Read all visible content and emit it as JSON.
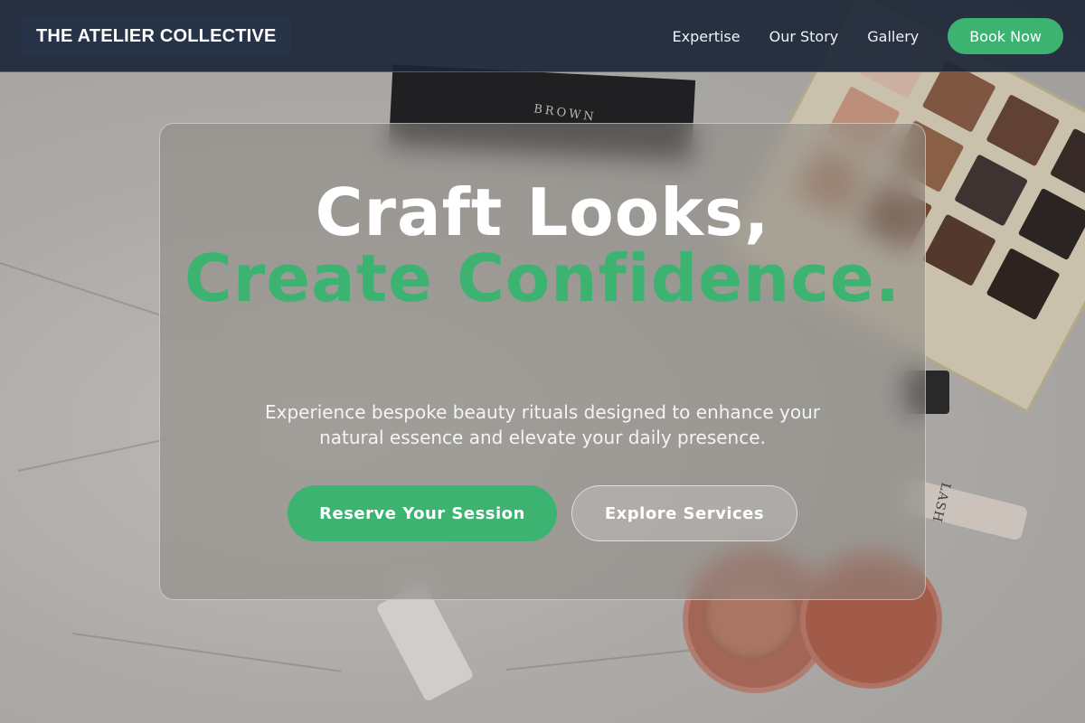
{
  "header": {
    "brand": "THE ATELIER COLLECTIVE",
    "nav": [
      {
        "label": "Expertise"
      },
      {
        "label": "Our Story"
      },
      {
        "label": "Gallery"
      }
    ],
    "book_label": "Book Now"
  },
  "hero": {
    "headline_line1": "Craft Looks,",
    "headline_line2": "Create Confidence.",
    "subtitle": "Experience bespoke beauty rituals designed to enhance your natural essence and elevate your daily presence.",
    "primary_cta": "Reserve Your Session",
    "secondary_cta": "Explore Services"
  },
  "background": {
    "compact_brand_text": "BROWN",
    "mascara_text": "LASH"
  },
  "colors": {
    "accent": "#3cb371",
    "header_bg": "#1c2637",
    "card_overlay": "#8c8884"
  }
}
